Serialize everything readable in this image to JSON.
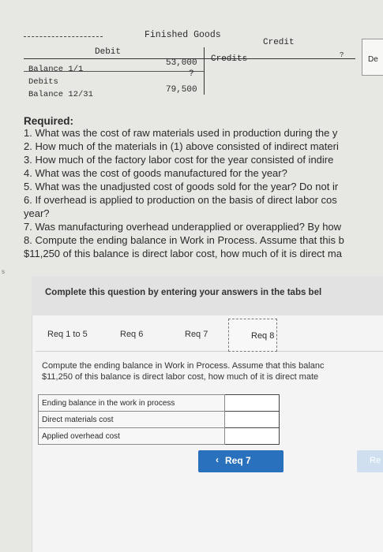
{
  "t_account": {
    "title": "Finished Goods",
    "debit_header": "Debit",
    "credit_header": "Credit",
    "credit_question": "?",
    "side_label": "De",
    "rows": [
      {
        "label": "Balance 1/1",
        "value": "53,000"
      },
      {
        "label": "Debits",
        "value": "?"
      },
      {
        "label": "Balance 12/31",
        "value": "79,500"
      }
    ],
    "credits_label": "Credits"
  },
  "required": {
    "heading": "Required:",
    "lines": [
      "1. What was the cost of raw materials used in production during the y",
      "2. How much of the materials in (1) above consisted of indirect materi",
      "3. How much of the factory labor cost for the year consisted of indire",
      "4. What was the cost of goods manufactured for the year?",
      "5. What was the unadjusted cost of goods sold for the year? Do not ir",
      "6. If overhead is applied to production on the basis of direct labor cos",
      "year?",
      "7. Was manufacturing overhead underapplied or overapplied? By how",
      "8. Compute the ending balance in Work in Process. Assume that this b",
      "$11,250 of this balance is direct labor cost, how much of it is direct ma"
    ]
  },
  "margin_mark": "s",
  "panel": {
    "banner": "Complete this question by entering your answers in the tabs bel",
    "tabs": [
      {
        "label": "Req 1 to 5"
      },
      {
        "label": "Req 6"
      },
      {
        "label": "Req 7"
      },
      {
        "label": "Req 8"
      }
    ],
    "instructions": [
      "Compute the ending balance in Work in Process. Assume that this balanc",
      "$11,250 of this balance is direct labor cost, how much of it is direct mate"
    ],
    "table_rows": [
      {
        "label": "Ending balance in the work in process",
        "value": ""
      },
      {
        "label": "Direct materials cost",
        "value": ""
      },
      {
        "label": "Applied overhead cost",
        "value": ""
      }
    ],
    "prev_button": "Req 7",
    "next_button": "Re"
  }
}
